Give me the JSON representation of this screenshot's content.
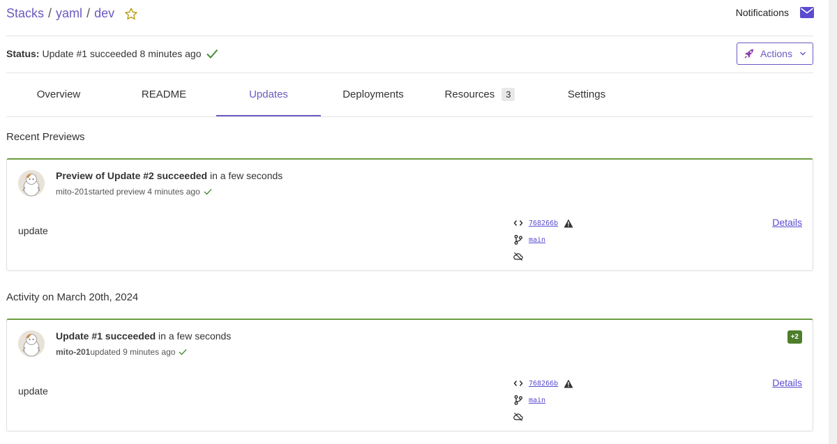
{
  "breadcrumb": {
    "stacks": "Stacks",
    "project": "yaml",
    "stack": "dev",
    "sep": "/"
  },
  "header": {
    "notifications_label": "Notifications"
  },
  "status": {
    "label": "Status:",
    "text": "Update #1 succeeded 8 minutes ago"
  },
  "actions": {
    "label": "Actions"
  },
  "tabs": [
    {
      "label": "Overview"
    },
    {
      "label": "README"
    },
    {
      "label": "Updates"
    },
    {
      "label": "Deployments"
    },
    {
      "label": "Resources",
      "count": "3"
    },
    {
      "label": "Settings"
    }
  ],
  "previews": {
    "title": "Recent Previews",
    "card": {
      "title_bold": "Preview of Update #2  succeeded",
      "title_rest": " in a few seconds",
      "user": "mito-201",
      "sub_text": " started preview 4 minutes ago",
      "message": "update",
      "commit": "768266b",
      "branch": "main",
      "details": "Details"
    }
  },
  "activity": {
    "title": "Activity on March 20th, 2024",
    "card": {
      "title_bold": "Update #1  succeeded",
      "title_rest": " in a few seconds",
      "user": "mito-201",
      "sub_text": " updated 9 minutes ago",
      "message": "update",
      "commit": "768266b",
      "branch": "main",
      "details": "Details",
      "badge": "+2"
    }
  },
  "colors": {
    "accent": "#6c59c2",
    "success": "#4a8a3b",
    "link": "#5a4bd0"
  }
}
